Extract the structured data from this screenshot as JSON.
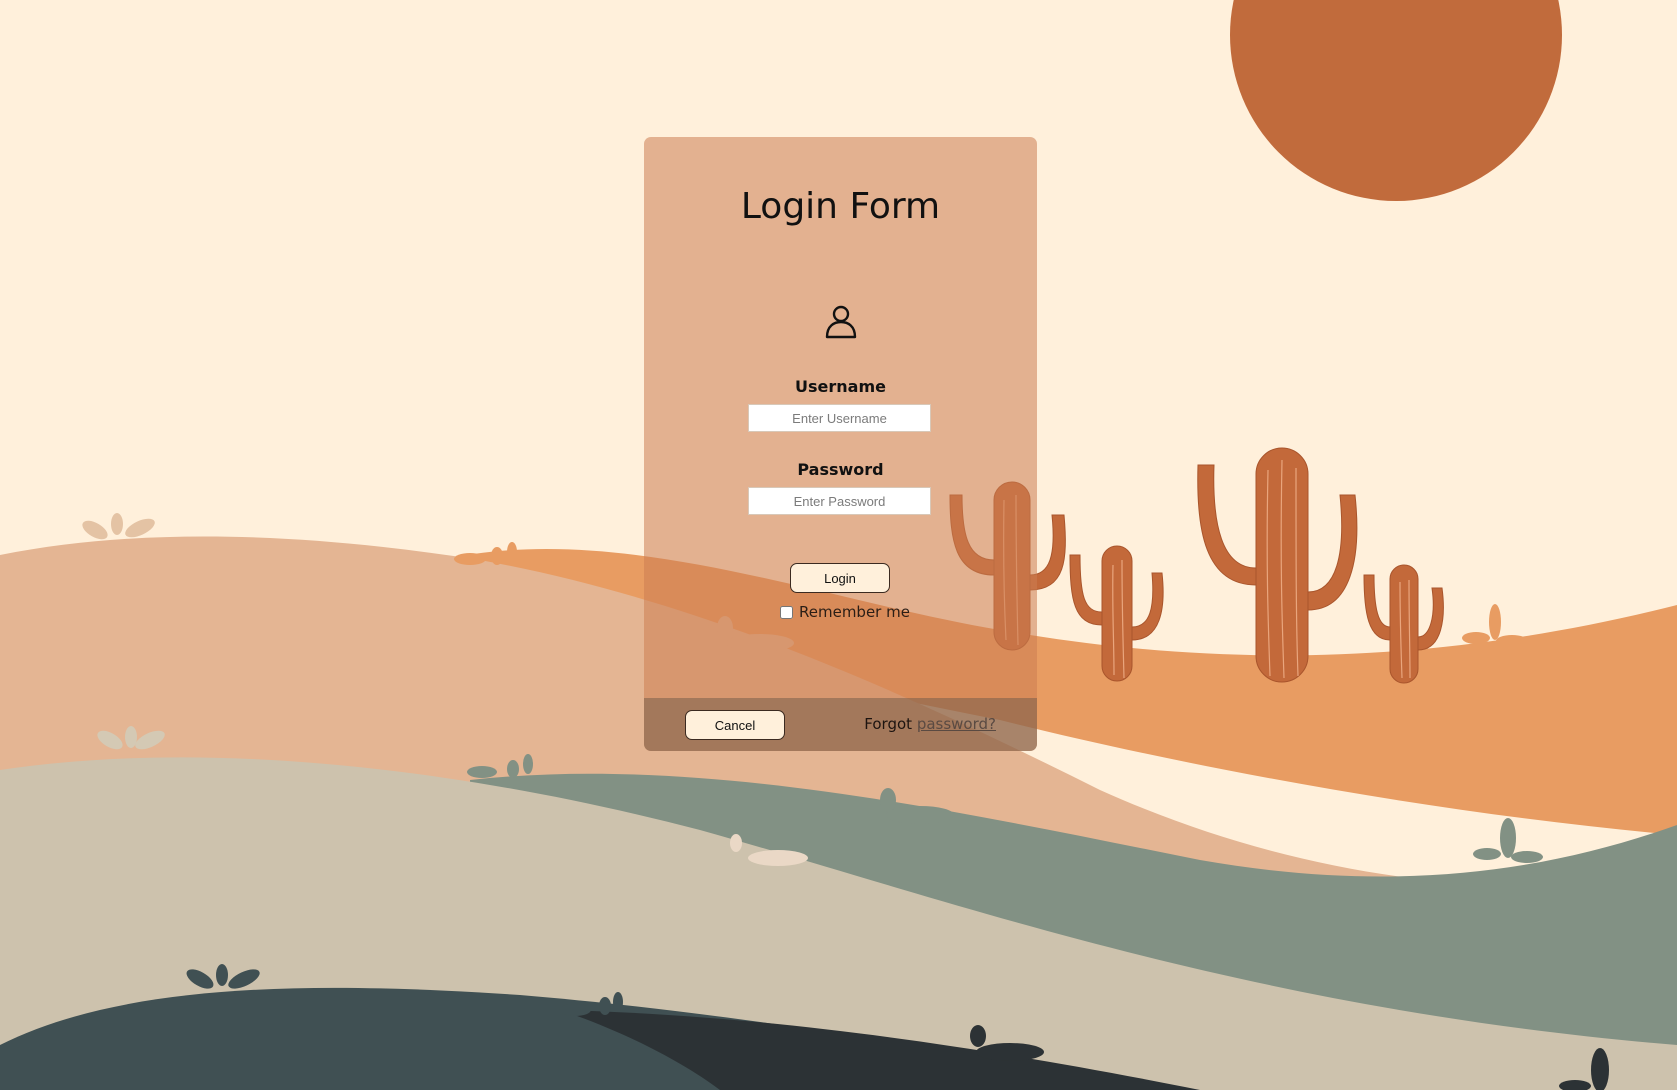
{
  "form": {
    "title": "Login Form",
    "username_label": "Username",
    "username_placeholder": "Enter Username",
    "password_label": "Password",
    "password_placeholder": "Enter Password",
    "login_label": "Login",
    "remember_label": "Remember me",
    "cancel_label": "Cancel",
    "forgot_prefix": "Forgot",
    "forgot_link": "password?"
  },
  "icons": {
    "user": "user-icon"
  },
  "colors": {
    "sky": "#fff0db",
    "sun": "#c16b3c",
    "card": "#e0b090",
    "button_bg": "#fff0db",
    "hill_orange": "#e89c62",
    "hill_peach": "#e4b593",
    "hill_sage": "#829184",
    "hill_sand": "#cdc2ad",
    "hill_slate": "#405053",
    "hill_dark": "#2c3235",
    "cactus": "#c3693a"
  }
}
